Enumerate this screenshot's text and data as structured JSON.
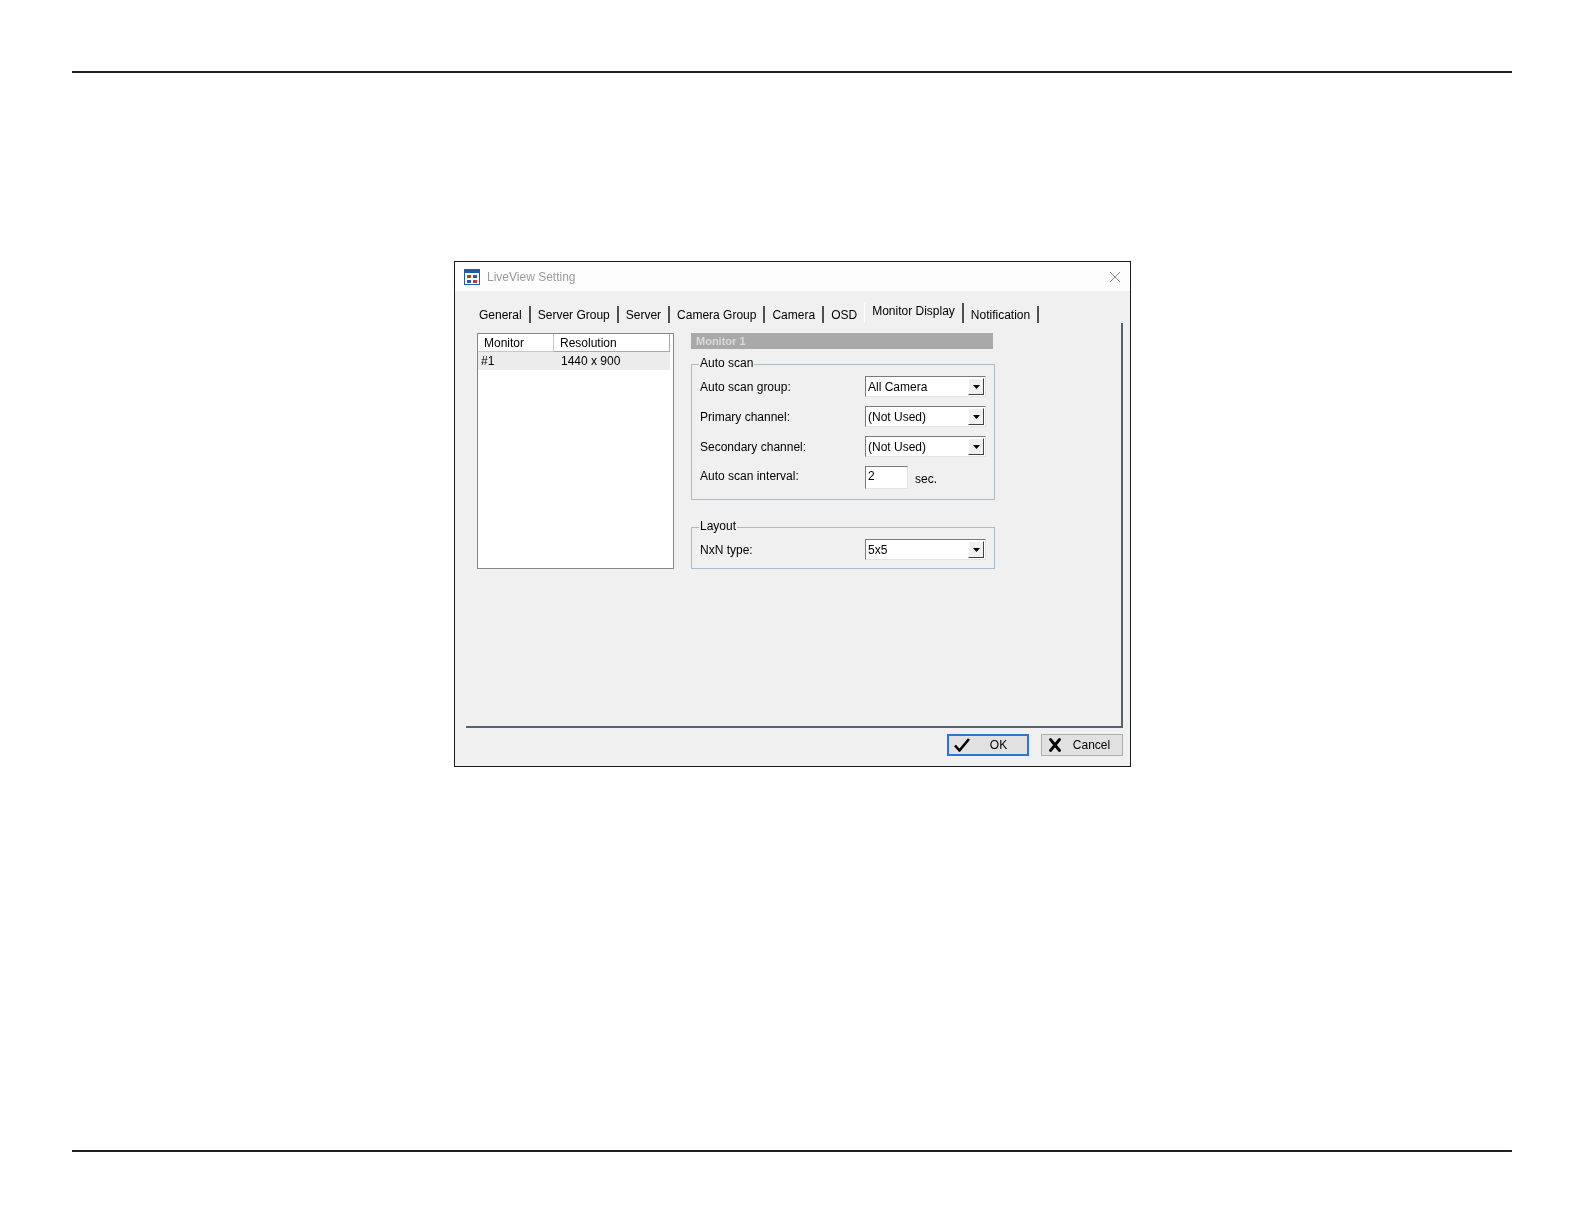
{
  "window": {
    "title": "LiveView Setting",
    "active": false
  },
  "tabs": [
    {
      "label": "General",
      "selected": false
    },
    {
      "label": "Server Group",
      "selected": false
    },
    {
      "label": "Server",
      "selected": false
    },
    {
      "label": "Camera Group",
      "selected": false
    },
    {
      "label": "Camera",
      "selected": false
    },
    {
      "label": "OSD",
      "selected": false
    },
    {
      "label": "Monitor Display",
      "selected": true
    },
    {
      "label": "Notification",
      "selected": false
    }
  ],
  "monitor_list": {
    "columns": [
      "Monitor",
      "Resolution"
    ],
    "rows": [
      {
        "cells": [
          "#1",
          "1440 x 900"
        ],
        "selected": true
      }
    ]
  },
  "monitor_panel": {
    "title": "Monitor 1",
    "groups": [
      {
        "title": "Auto scan",
        "fields": [
          {
            "kind": "dropdown",
            "label": "Auto scan group:",
            "value": "All Camera"
          },
          {
            "kind": "dropdown",
            "label": "Primary channel:",
            "value": "(Not Used)"
          },
          {
            "kind": "dropdown",
            "label": "Secondary channel:",
            "value": "(Not Used)"
          },
          {
            "kind": "number",
            "label": "Auto scan interval:",
            "value": "2",
            "unit": "sec."
          }
        ]
      },
      {
        "title": "Layout",
        "fields": [
          {
            "kind": "dropdown",
            "label": "NxN type:",
            "value": "5x5"
          }
        ]
      }
    ]
  },
  "buttons": [
    {
      "kind": "ok",
      "label": "OK",
      "default": true
    },
    {
      "kind": "cancel",
      "label": "Cancel",
      "default": false
    }
  ]
}
